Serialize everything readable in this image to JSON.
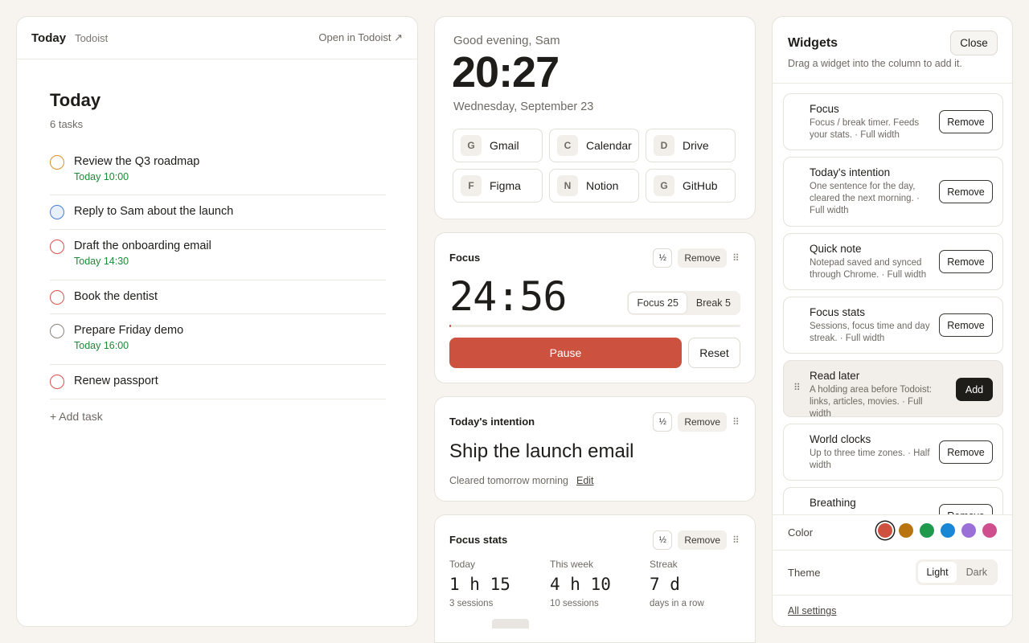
{
  "tasks_panel": {
    "header_title": "Today",
    "header_source": "Todoist",
    "open_link": "Open in Todoist ↗",
    "heading": "Today",
    "count": "6 tasks",
    "tasks": [
      {
        "name": "Review the Q3 roadmap",
        "due": "Today 10:00",
        "color": "#d9922a"
      },
      {
        "name": "Reply to Sam about the launch",
        "due": "",
        "color": "#4a7fd0"
      },
      {
        "name": "Draft the onboarding email",
        "due": "Today 14:30",
        "color": "#d9534a"
      },
      {
        "name": "Book the dentist",
        "due": "",
        "color": "#d9534a"
      },
      {
        "name": "Prepare Friday demo",
        "due": "Today 16:00",
        "color": "#8a857e"
      },
      {
        "name": "Renew passport",
        "due": "",
        "color": "#d9534a"
      }
    ],
    "add_task": "+ Add task"
  },
  "greeting_card": {
    "greeting": "Good evening, Sam",
    "time": "20:27",
    "date": "Wednesday, September 23",
    "shortcuts": [
      {
        "letter": "G",
        "label": "Gmail"
      },
      {
        "letter": "C",
        "label": "Calendar"
      },
      {
        "letter": "D",
        "label": "Drive"
      },
      {
        "letter": "F",
        "label": "Figma"
      },
      {
        "letter": "N",
        "label": "Notion"
      },
      {
        "letter": "G",
        "label": "GitHub"
      }
    ]
  },
  "card_controls": {
    "half": "½",
    "remove": "Remove"
  },
  "focus_card": {
    "title": "Focus",
    "timer": "24:56",
    "modes": [
      "Focus 25",
      "Break 5"
    ],
    "progress": 0.0027,
    "pause": "Pause",
    "reset": "Reset"
  },
  "intention_card": {
    "title": "Today's intention",
    "text": "Ship the launch email",
    "sub": "Cleared tomorrow morning",
    "edit": "Edit"
  },
  "stats_card": {
    "title": "Focus stats",
    "stats": [
      {
        "label": "Today",
        "value": "1 h 15",
        "sub": "3 sessions"
      },
      {
        "label": "This week",
        "value": "4 h 10",
        "sub": "10 sessions"
      },
      {
        "label": "Streak",
        "value": "7 d",
        "sub": "days in a row"
      }
    ]
  },
  "widgets_panel": {
    "title": "Widgets",
    "close": "Close",
    "subtitle": "Drag a widget into the column to add it.",
    "items": [
      {
        "name": "Focus",
        "desc": "Focus / break timer. Feeds your stats. · Full width",
        "action": "Remove"
      },
      {
        "name": "Today's intention",
        "desc": "One sentence for the day, cleared the next morning. · Full width",
        "action": "Remove"
      },
      {
        "name": "Quick note",
        "desc": "Notepad saved and synced through Chrome. · Full width",
        "action": "Remove"
      },
      {
        "name": "Focus stats",
        "desc": "Sessions, focus time and day streak. · Full width",
        "action": "Remove"
      },
      {
        "name": "Read later",
        "desc": "A holding area before Todoist: links, articles, movies. · Full width",
        "action": "Add"
      },
      {
        "name": "World clocks",
        "desc": "Up to three time zones. · Half width",
        "action": "Remove"
      },
      {
        "name": "Breathing",
        "desc": "",
        "action": "Remove"
      }
    ],
    "color_label": "Color",
    "colors": [
      "#cc523f",
      "#b8740f",
      "#1f9a4d",
      "#1787d6",
      "#9a6fd8",
      "#cf4f8e"
    ],
    "selected_color": "#cc523f",
    "theme_label": "Theme",
    "theme_options": [
      "Light",
      "Dark"
    ],
    "theme_selected": "Light",
    "all_settings": "All settings"
  }
}
